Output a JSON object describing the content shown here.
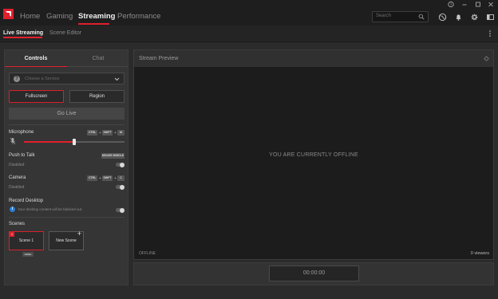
{
  "app": {
    "brand_color": "#e0202d"
  },
  "nav": {
    "items": [
      "Home",
      "Gaming",
      "Streaming",
      "Performance"
    ],
    "active": "Streaming"
  },
  "search": {
    "placeholder": "Search"
  },
  "topbar_icons": [
    "globe-icon",
    "bell-icon",
    "gear-icon",
    "sidebar-toggle-icon"
  ],
  "window_controls": [
    "help-icon",
    "minimize-icon",
    "maximize-icon",
    "close-icon"
  ],
  "tabs": {
    "items": [
      "Live Streaming",
      "Scene Editor"
    ],
    "active": "Live Streaming"
  },
  "left_panel": {
    "tabs": [
      "Controls",
      "Chat"
    ],
    "device": {
      "placeholder": "Choose a Service"
    },
    "capture": {
      "fullscreen": "Fullscreen",
      "region": "Region"
    },
    "go_live": "Go Live",
    "microphone": {
      "label": "Microphone",
      "keys": [
        "CTRL",
        "SHIFT",
        "M"
      ],
      "volume_percent": 50
    },
    "push_to_talk": {
      "label": "Push to Talk",
      "key": "MOUSE MIDDLE",
      "status": "Disabled"
    },
    "camera": {
      "label": "Camera",
      "keys": [
        "CTRL",
        "SHIFT",
        "C"
      ],
      "status": "Disabled"
    },
    "record_desktop": {
      "label": "Record Desktop",
      "info": "Your desktop content will be blacked out."
    },
    "scenes": {
      "label": "Scenes",
      "items": [
        {
          "number": "1",
          "name": "Scene 1",
          "hotkey": "NONE"
        }
      ],
      "new_label": "New Scene"
    }
  },
  "preview": {
    "title": "Stream Preview",
    "message": "YOU ARE CURRENTLY OFFLINE",
    "status": "OFFLINE",
    "viewers": "0 viewers",
    "timer": "00:00:00"
  }
}
